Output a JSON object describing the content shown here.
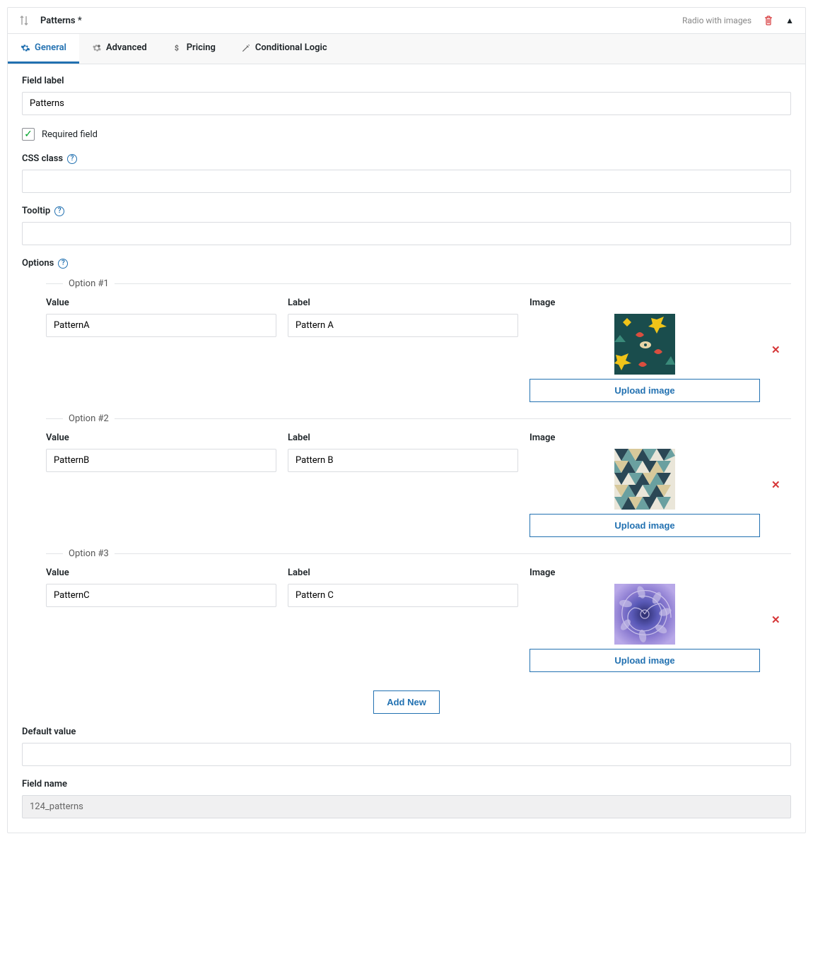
{
  "header": {
    "title": "Patterns *",
    "fieldType": "Radio with images"
  },
  "tabs": [
    {
      "label": "General",
      "active": true
    },
    {
      "label": "Advanced",
      "active": false
    },
    {
      "label": "Pricing",
      "active": false
    },
    {
      "label": "Conditional Logic",
      "active": false
    }
  ],
  "labels": {
    "fieldLabel": "Field label",
    "requiredField": "Required field",
    "cssClass": "CSS class",
    "tooltip": "Tooltip",
    "options": "Options",
    "value": "Value",
    "label": "Label",
    "image": "Image",
    "uploadImage": "Upload image",
    "addNew": "Add New",
    "defaultValue": "Default value",
    "fieldName": "Field name"
  },
  "values": {
    "fieldLabel": "Patterns",
    "requiredChecked": true,
    "cssClass": "",
    "tooltip": "",
    "defaultValue": "",
    "fieldName": "124_patterns"
  },
  "options": [
    {
      "legend": "Option #1",
      "value": "PatternA",
      "label": "Pattern A"
    },
    {
      "legend": "Option #2",
      "value": "PatternB",
      "label": "Pattern B"
    },
    {
      "legend": "Option #3",
      "value": "PatternC",
      "label": "Pattern C"
    }
  ]
}
